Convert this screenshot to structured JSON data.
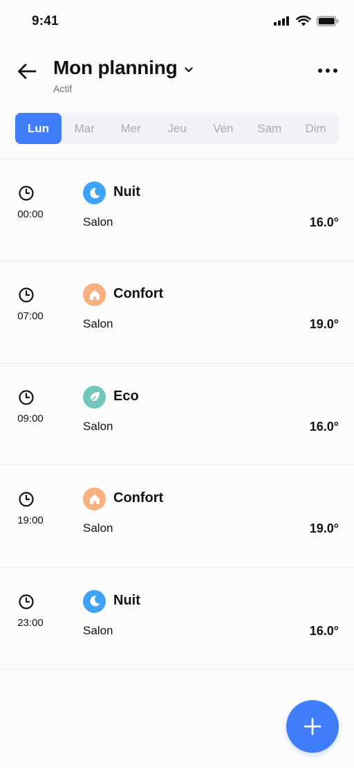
{
  "status_bar": {
    "time": "9:41"
  },
  "header": {
    "title": "Mon planning",
    "subtitle": "Actif"
  },
  "days": [
    {
      "label": "Lun",
      "active": true
    },
    {
      "label": "Mar",
      "active": false
    },
    {
      "label": "Mer",
      "active": false
    },
    {
      "label": "Jeu",
      "active": false
    },
    {
      "label": "Ven",
      "active": false
    },
    {
      "label": "Sam",
      "active": false
    },
    {
      "label": "Dim",
      "active": false
    }
  ],
  "schedule": [
    {
      "time": "00:00",
      "mode": "Nuit",
      "icon": "moon-icon",
      "color": "#3ea2f5",
      "room": "Salon",
      "temp": "16.0°"
    },
    {
      "time": "07:00",
      "mode": "Confort",
      "icon": "home-icon",
      "color": "#f8b07f",
      "room": "Salon",
      "temp": "19.0°"
    },
    {
      "time": "09:00",
      "mode": "Eco",
      "icon": "leaf-icon",
      "color": "#72c7bd",
      "room": "Salon",
      "temp": "16.0°"
    },
    {
      "time": "19:00",
      "mode": "Confort",
      "icon": "home-icon",
      "color": "#f8b07f",
      "room": "Salon",
      "temp": "19.0°"
    },
    {
      "time": "23:00",
      "mode": "Nuit",
      "icon": "moon-icon",
      "color": "#3ea2f5",
      "room": "Salon",
      "temp": "16.0°"
    }
  ],
  "colors": {
    "accent": "#3f7ef8",
    "inactive_day": "#a9a9b7",
    "subtitle": "#6e6f82"
  }
}
